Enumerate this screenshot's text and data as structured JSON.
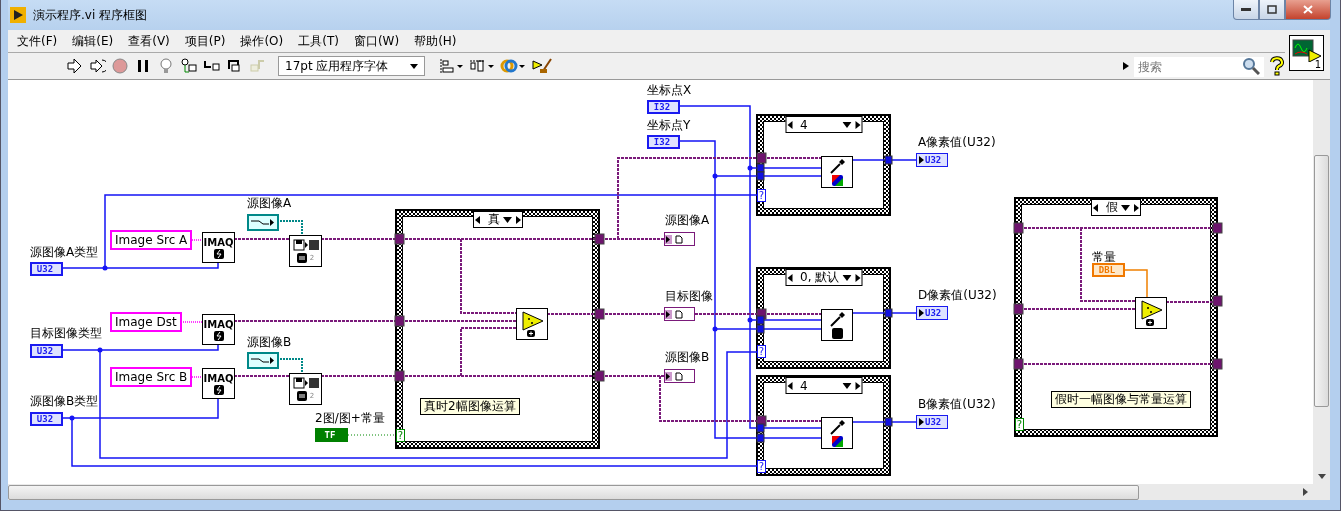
{
  "window": {
    "title": "演示程序.vi 程序框图"
  },
  "menu": [
    {
      "label": "文件(F)"
    },
    {
      "label": "编辑(E)"
    },
    {
      "label": "查看(V)"
    },
    {
      "label": "项目(P)"
    },
    {
      "label": "操作(O)"
    },
    {
      "label": "工具(T)"
    },
    {
      "label": "窗口(W)"
    },
    {
      "label": "帮助(H)"
    }
  ],
  "toolbar": {
    "font": "17pt 应用程序字体",
    "search": {
      "placeholder": "搜索"
    },
    "connector_number": "1"
  },
  "diagram": {
    "controls": [
      {
        "label": "源图像A类型",
        "type": "U32",
        "kind": "integer"
      },
      {
        "label": "目标图像类型",
        "type": "U32",
        "kind": "integer"
      },
      {
        "label": "源图像B类型",
        "type": "U32",
        "kind": "integer"
      },
      {
        "label": "坐标点X",
        "type": "I32",
        "kind": "integer"
      },
      {
        "label": "坐标点Y",
        "type": "I32",
        "kind": "integer"
      },
      {
        "label": "2图/图+常量",
        "type": "TF",
        "kind": "boolean"
      }
    ],
    "image_names": [
      "Image Src A",
      "Image Dst",
      "Image Src B"
    ],
    "imaq_nodes": [
      "IMAQ",
      "IMAQ",
      "IMAQ"
    ],
    "path_constants": [
      {
        "label": "源图像A"
      },
      {
        "label": "源图像B"
      }
    ],
    "file_nodes": [
      {
        "badge": "2"
      },
      {
        "badge": "2"
      }
    ],
    "image_indicators": [
      {
        "label": "源图像A"
      },
      {
        "label": "目标图像"
      },
      {
        "label": "源图像B"
      }
    ],
    "case_structures": [
      {
        "kind": "compute",
        "selector": "真",
        "selector_terminal": "?",
        "comment": "真时2幅图像运算"
      },
      {
        "kind": "pixel",
        "selector": "4",
        "selector_terminal": "?",
        "rgb": true,
        "output": {
          "label": "A像素值(U32)",
          "type": "U32"
        }
      },
      {
        "kind": "pixel",
        "selector": "0, 默认",
        "selector_terminal": "?",
        "rgb": false,
        "output": {
          "label": "D像素值(U32)",
          "type": "U32"
        }
      },
      {
        "kind": "pixel",
        "selector": "4",
        "selector_terminal": "?",
        "rgb": true,
        "output": {
          "label": "B像素值(U32)",
          "type": "U32"
        }
      },
      {
        "kind": "compute",
        "selector": "假",
        "selector_terminal": "?",
        "comment": "假时一幅图像与常量运算",
        "constant": {
          "label": "常量",
          "type": "DBL",
          "kind": "float"
        }
      }
    ]
  }
}
